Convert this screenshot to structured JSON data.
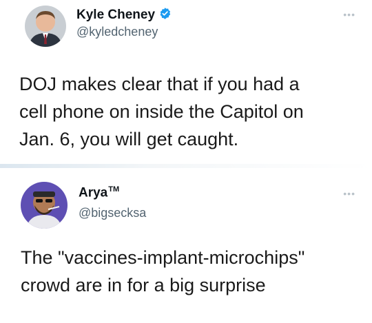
{
  "tweets": [
    {
      "display_name": "Kyle Cheney",
      "verified": true,
      "handle": "@kyledcheney",
      "text": "DOJ makes clear that if you had a\ncell phone on inside the Capitol on\nJan. 6, you will get caught.",
      "more_icon": "more-dots-icon",
      "verified_icon": "verified-badge-icon",
      "colors": {
        "verified": "#1d9bf0"
      }
    },
    {
      "display_name": "Arya",
      "name_suffix": "TM",
      "handle": "@bigsecksa",
      "text": "The \"vaccines-implant-microchips\"\ncrowd are in for a big surprise",
      "more_icon": "more-dots-icon"
    }
  ],
  "colors": {
    "text": "#0f1419",
    "secondary": "#536471",
    "background": "#ffffff"
  }
}
